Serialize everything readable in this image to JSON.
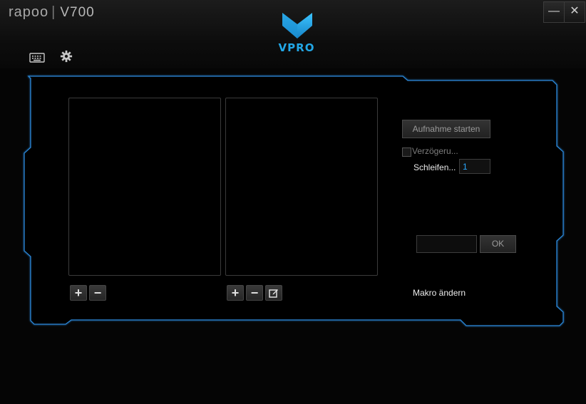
{
  "titlebar": {
    "brand": "rapoo",
    "separator": "|",
    "model": "V700",
    "logo_text": "VPRO",
    "minimize_symbol": "—",
    "close_symbol": "✕"
  },
  "toolbar": {
    "icons": [
      "keyboard-icon",
      "gear-icon"
    ]
  },
  "macro_panel": {
    "record_button": "Aufnahme starten",
    "delay_checkbox_label": "Verzögeru...",
    "delay_checked": false,
    "loops_label": "Schleifen...",
    "loops_value": "1",
    "ok_button": "OK",
    "edit_macro_label": "Makro ändern",
    "name_input_value": ""
  },
  "list_buttons": {
    "add": "+",
    "remove": "−"
  },
  "colors": {
    "accent": "#22a7e6",
    "frame_glow": "#1f78c8",
    "background": "#050505"
  }
}
